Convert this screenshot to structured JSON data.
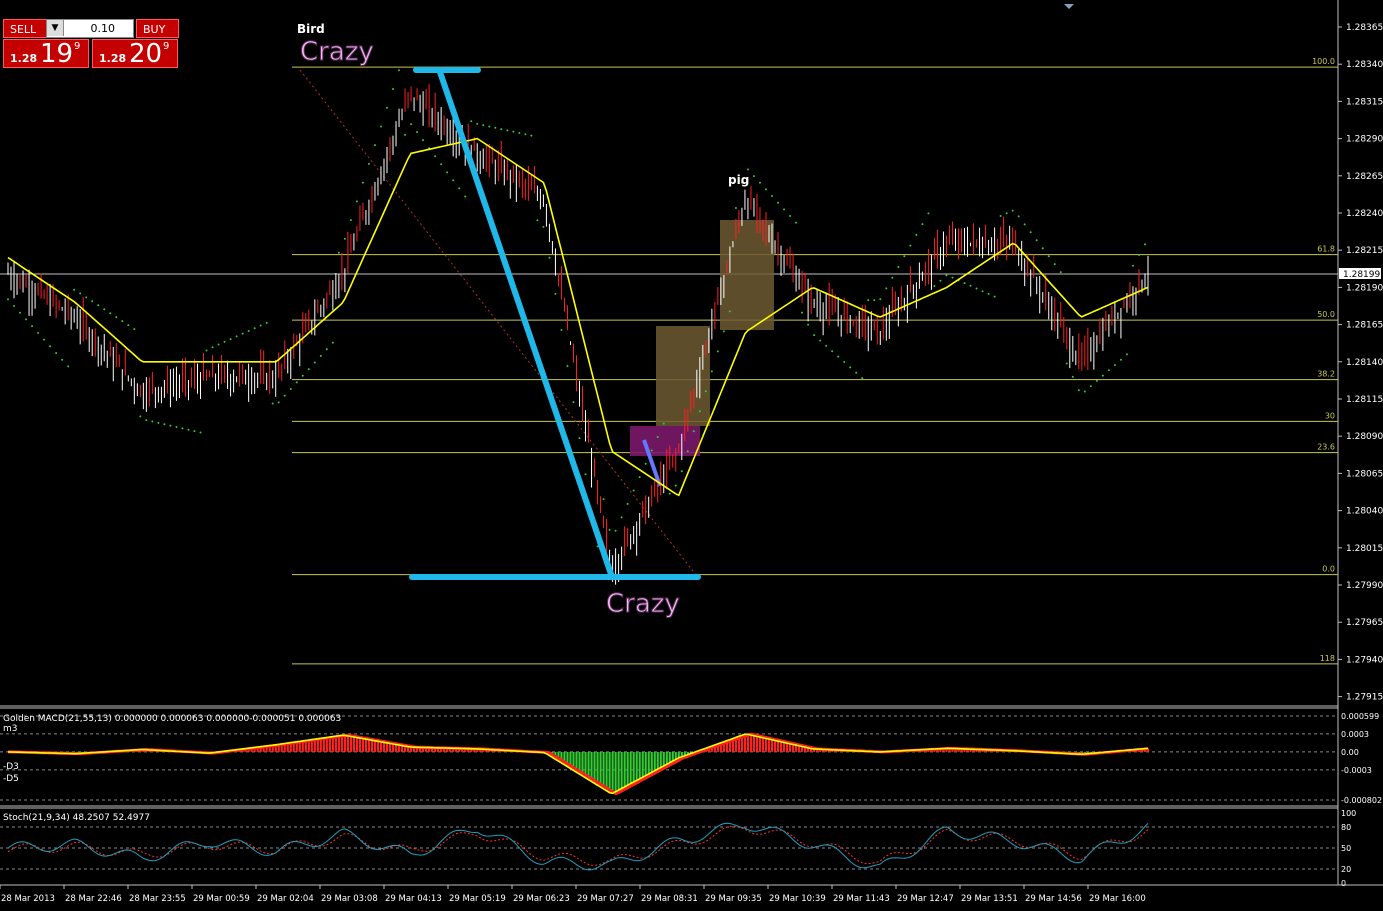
{
  "trade_panel": {
    "sell_label": "SELL",
    "buy_label": "BUY",
    "lot_value": "0.10",
    "sell_prefix": "1.28",
    "sell_big": "19",
    "sell_sup": "9",
    "buy_prefix": "1.28",
    "buy_big": "20",
    "buy_sup": "9"
  },
  "annotations": {
    "bird": "Bird",
    "crazy_top": "Crazy",
    "crazy_bottom": "Crazy",
    "pig": "pig"
  },
  "colors": {
    "background": "#000000",
    "candle": "#ff2020",
    "candle_alt": "#ffffff",
    "ma_yellow": "#ffff00",
    "psar_green": "#33cc33",
    "fib_line": "#c8c850",
    "current_price_line": "#c0c0c0",
    "drawn_blue": "#1fb8e8",
    "zone_brown": "#6e5a33",
    "zone_purple": "#7a1a6a",
    "crazy_text": "#f5b8f5",
    "macd_red": "#ff2020",
    "macd_green": "#33cc33",
    "macd_yellow": "#ffff00",
    "stoch_main": "#20a0c0",
    "stoch_signal": "#ff3030"
  },
  "main_chart": {
    "y_ticks": [
      "1.28365",
      "1.28340",
      "1.28315",
      "1.28290",
      "1.28265",
      "1.28240",
      "1.28215",
      "1.28190",
      "1.28165",
      "1.28140",
      "1.28115",
      "1.28090",
      "1.28065",
      "1.28040",
      "1.28015",
      "1.27990",
      "1.27965",
      "1.27940",
      "1.27915"
    ],
    "current_price": "1.28199",
    "fib_labels": [
      "100.0",
      "61.8",
      "50.0",
      "38.2",
      "30",
      "23.6",
      "0.0",
      "118"
    ]
  },
  "macd_panel": {
    "title": "Golden MACD(21,55,13) 0.000000 0.000063 0.000000-0.000051 0.000063",
    "left_labels": [
      "m3",
      "-D3",
      "-D5"
    ],
    "y_ticks": [
      "0.000599",
      "0.0003",
      "0.00",
      "-0.0003",
      "-0.000802"
    ]
  },
  "stoch_panel": {
    "title": "Stoch(21,9,34) 48.2507 52.4977",
    "y_ticks": [
      "100",
      "80",
      "50",
      "20",
      "0"
    ]
  },
  "time_axis": [
    "28 Mar 2013",
    "28 Mar 22:46",
    "28 Mar 23:55",
    "29 Mar 00:59",
    "29 Mar 02:04",
    "29 Mar 03:08",
    "29 Mar 04:13",
    "29 Mar 05:19",
    "29 Mar 06:23",
    "29 Mar 07:27",
    "29 Mar 08:31",
    "29 Mar 09:35",
    "29 Mar 10:39",
    "29 Mar 11:43",
    "29 Mar 12:47",
    "29 Mar 13:51",
    "29 Mar 14:56",
    "29 Mar 16:00"
  ],
  "chart_data": [
    {
      "type": "line",
      "panel": "price",
      "x_label_kind": "time",
      "ylim": [
        1.279,
        1.2838
      ],
      "series": [
        {
          "kind": "close",
          "x": [
            "28 Mar 2013",
            "28 Mar 22:46",
            "28 Mar 23:55",
            "29 Mar 00:59",
            "29 Mar 02:04",
            "29 Mar 03:08",
            "29 Mar 04:13",
            "29 Mar 05:19",
            "29 Mar 06:23",
            "29 Mar 07:27",
            "29 Mar 08:31",
            "29 Mar 09:35",
            "29 Mar 10:39",
            "29 Mar 11:43",
            "29 Mar 12:47",
            "29 Mar 13:51",
            "29 Mar 14:56",
            "29 Mar 16:00"
          ],
          "values": [
            1.282,
            1.2817,
            1.2812,
            1.2813,
            1.2813,
            1.282,
            1.2832,
            1.2828,
            1.2825,
            1.28,
            1.2808,
            1.2825,
            1.2818,
            1.2816,
            1.2822,
            1.2822,
            1.2814,
            1.282
          ]
        },
        {
          "kind": "moving_average",
          "values": [
            1.2821,
            1.2818,
            1.2814,
            1.2814,
            1.2814,
            1.2818,
            1.2828,
            1.2829,
            1.2826,
            1.2808,
            1.2805,
            1.2816,
            1.2819,
            1.2817,
            1.2819,
            1.2822,
            1.2817,
            1.2819
          ]
        }
      ],
      "fib_levels": [
        {
          "label": "100.0",
          "value": 1.28338
        },
        {
          "label": "61.8",
          "value": 1.28212
        },
        {
          "label": "50.0",
          "value": 1.28168
        },
        {
          "label": "38.2",
          "value": 1.28128
        },
        {
          "label": "30",
          "value": 1.281
        },
        {
          "label": "23.6",
          "value": 1.28079
        },
        {
          "label": "0.0",
          "value": 1.27997
        },
        {
          "label": "118",
          "value": 1.27937
        }
      ],
      "current_price": 1.28199
    },
    {
      "type": "area",
      "panel": "macd",
      "ylim": [
        -0.000802,
        0.000599
      ],
      "values": [
        0.0,
        -3e-05,
        4e-05,
        -2e-05,
        0.00012,
        0.00028,
        8e-05,
        5e-05,
        -1e-05,
        -0.0007,
        -0.0001,
        0.0003,
        5e-05,
        0.0,
        6e-05,
        2e-05,
        -4e-05,
        6e-05
      ]
    },
    {
      "type": "line",
      "panel": "stochastic",
      "ylim": [
        0,
        100
      ],
      "series": [
        {
          "kind": "main",
          "values": [
            50,
            55,
            35,
            60,
            45,
            70,
            40,
            80,
            30,
            25,
            60,
            85,
            55,
            20,
            75,
            60,
            35,
            80
          ]
        },
        {
          "kind": "signal",
          "values": [
            48,
            52,
            40,
            55,
            48,
            65,
            45,
            72,
            38,
            30,
            55,
            80,
            58,
            28,
            70,
            62,
            40,
            75
          ]
        }
      ]
    }
  ]
}
